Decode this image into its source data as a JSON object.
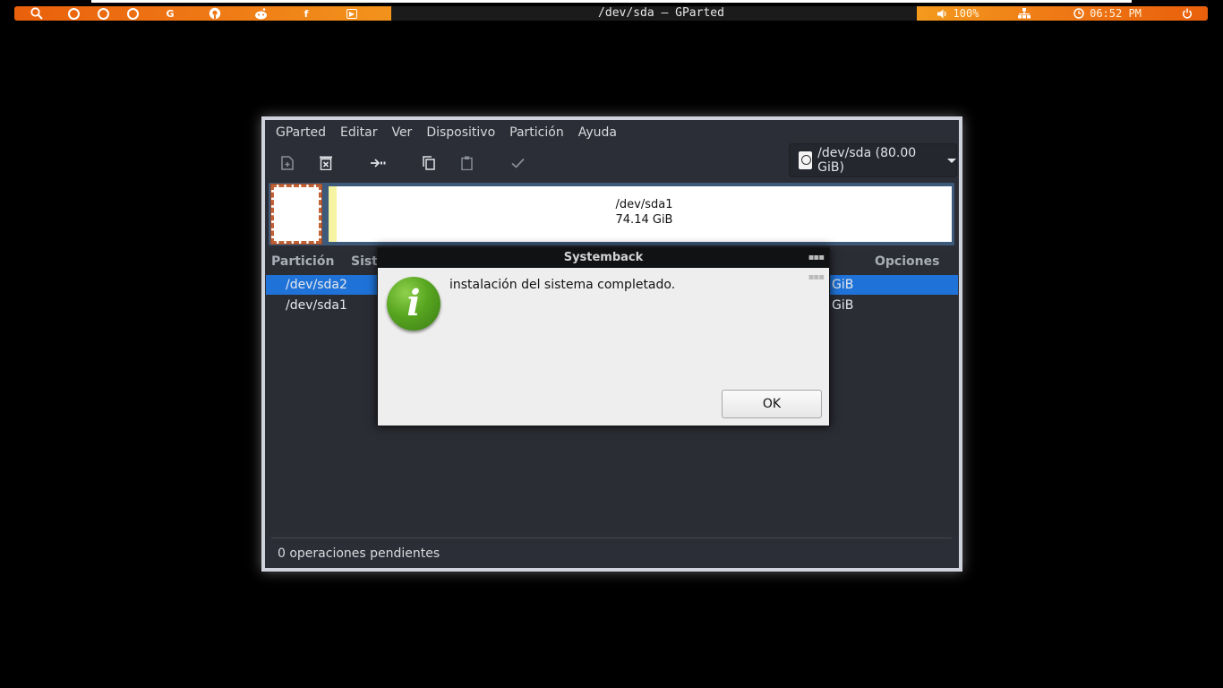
{
  "panel": {
    "window_title": "/dev/sda – GParted",
    "launchers": [
      {
        "icon": "search-icon",
        "label": ""
      },
      {
        "icon": "circle-icon",
        "label": ""
      },
      {
        "icon": "circle-icon",
        "label": ""
      },
      {
        "icon": "circle-icon",
        "label": ""
      },
      {
        "icon": "google-icon",
        "label": "G"
      },
      {
        "icon": "github-icon",
        "label": ""
      },
      {
        "icon": "reddit-icon",
        "label": ""
      },
      {
        "icon": "facebook-icon",
        "label": "f"
      },
      {
        "icon": "youtube-icon",
        "label": "▶"
      }
    ],
    "volume": "100%",
    "clock": "06:52 PM",
    "colors": {
      "accent": "#ee7514",
      "accent_light": "#f39a1d"
    }
  },
  "gparted": {
    "menus": [
      "GParted",
      "Editar",
      "Ver",
      "Dispositivo",
      "Partición",
      "Ayuda"
    ],
    "toolbar_icons": [
      "new-partition-icon",
      "delete-partition-icon",
      "resize-move-icon",
      "copy-icon",
      "paste-icon",
      "apply-icon"
    ],
    "device_selector": "/dev/sda (80.00 GiB)",
    "map": {
      "partition_name": "/dev/sda1",
      "partition_size": "74.14 GiB"
    },
    "columns": {
      "partition": "Partición",
      "filesystem": "Sist",
      "options": "Opciones"
    },
    "rows": [
      {
        "partition": "/dev/sda2",
        "tail": "GiB",
        "selected": true
      },
      {
        "partition": "/dev/sda1",
        "tail": "GiB",
        "selected": false
      }
    ],
    "status": "0 operaciones pendientes",
    "colors": {
      "selection": "#1f73d8",
      "unallocated_border": "#c06236",
      "ext4_stripe": "#f6f4a3"
    }
  },
  "dialog": {
    "title": "Systemback",
    "message": "instalación del sistema completado.",
    "ok_label": "OK",
    "icon": "info-icon",
    "icon_glyph": "i"
  }
}
